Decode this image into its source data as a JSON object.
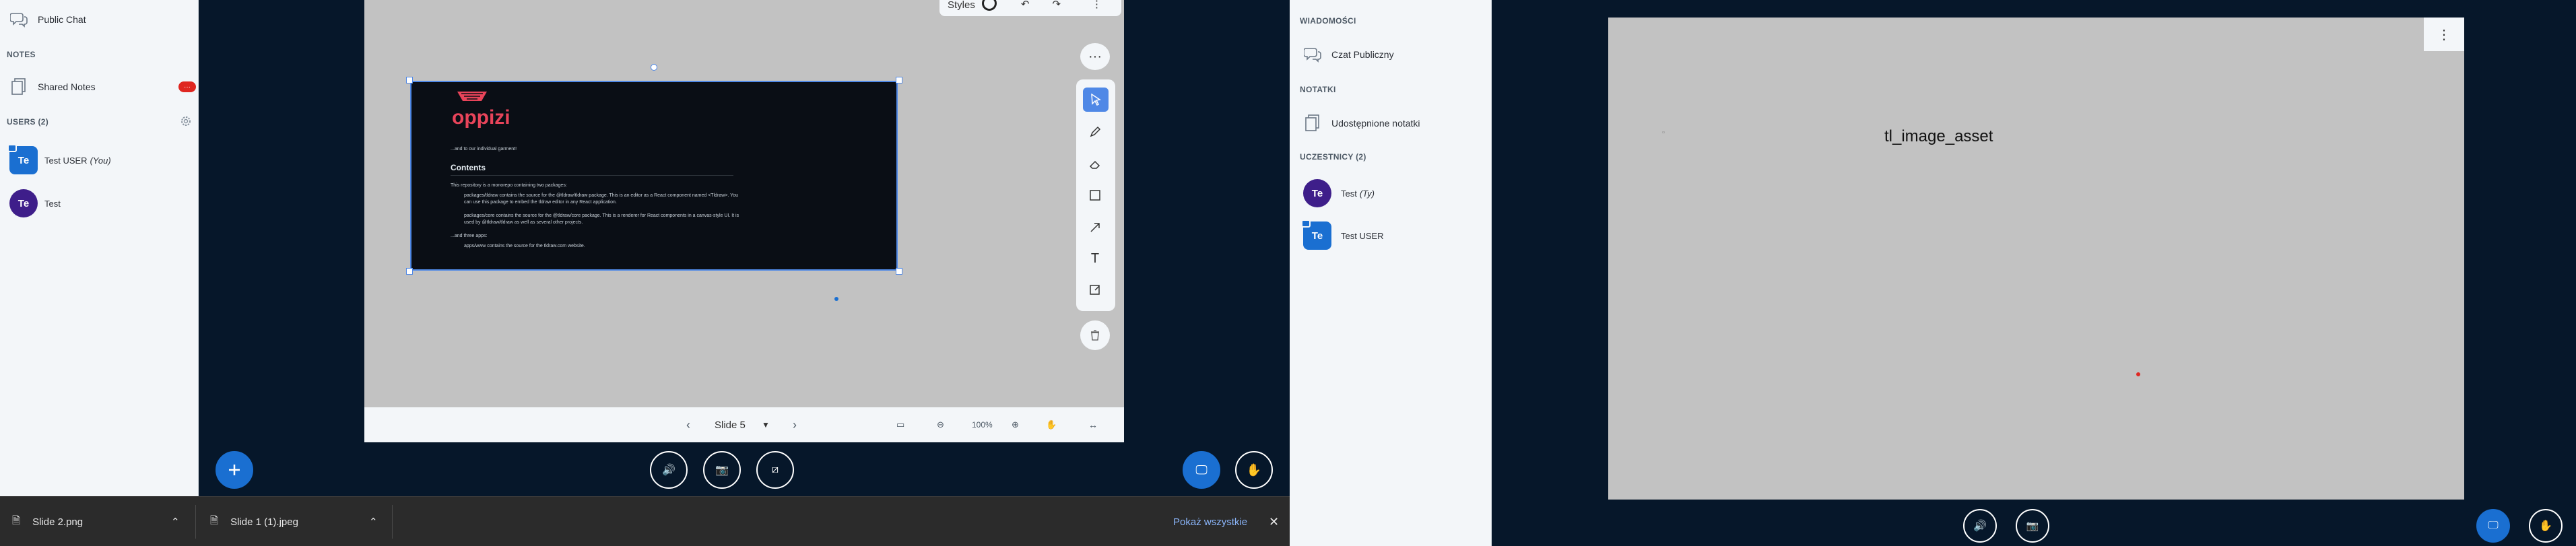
{
  "left_session": {
    "sidebar": {
      "public_chat": "Public Chat",
      "notes_header": "NOTES",
      "shared_notes": "Shared Notes",
      "users_header": "USERS (2)",
      "users": [
        {
          "initials": "Te",
          "name": "Test USER",
          "suffix": "(You)"
        },
        {
          "initials": "Te",
          "name": "Test",
          "suffix": ""
        }
      ]
    },
    "toolbar_top": {
      "styles": "Styles"
    },
    "slide": {
      "brand": "oppizi",
      "intro": "...and to our individual garment!",
      "heading": "Contents",
      "line1": "This repository is a monorepo containing two packages:",
      "bullet1": "packages/tldraw contains the source for the @tldraw/tldraw package. This is an editor as a React component named <Tldraw>. You can use this package to embed the tldraw editor in any React application.",
      "bullet2": "packages/core contains the source for the @tldraw/core package. This is a renderer for React components in a canvas-style UI. It is used by @tldraw/tldraw as well as several other projects.",
      "line2": "...and three apps:",
      "bullet3": "apps/www contains the source for the tldraw.com website."
    },
    "pres_controls": {
      "slide_label": "Slide 5",
      "zoom": "100%"
    },
    "downloads": {
      "item1": "Slide 2.png",
      "item2": "Slide 1 (1).jpeg",
      "show_all": "Pokaż wszystkie"
    }
  },
  "right_session": {
    "sidebar": {
      "messages_header": "WIADOMOŚCI",
      "public_chat": "Czat Publiczny",
      "notes_header": "NOTATKI",
      "shared_notes": "Udostępnione notatki",
      "users_header": "UCZESTNICY (2)",
      "users": [
        {
          "initials": "Te",
          "name": "Test",
          "suffix": "(Ty)"
        },
        {
          "initials": "Te",
          "name": "Test USER",
          "suffix": ""
        }
      ]
    },
    "stage": {
      "broken_image_alt": "tl_image_asset"
    }
  },
  "colors": {
    "accent": "#1a6fd1",
    "dark_bg": "#06172a",
    "badge_red": "#df2721"
  }
}
